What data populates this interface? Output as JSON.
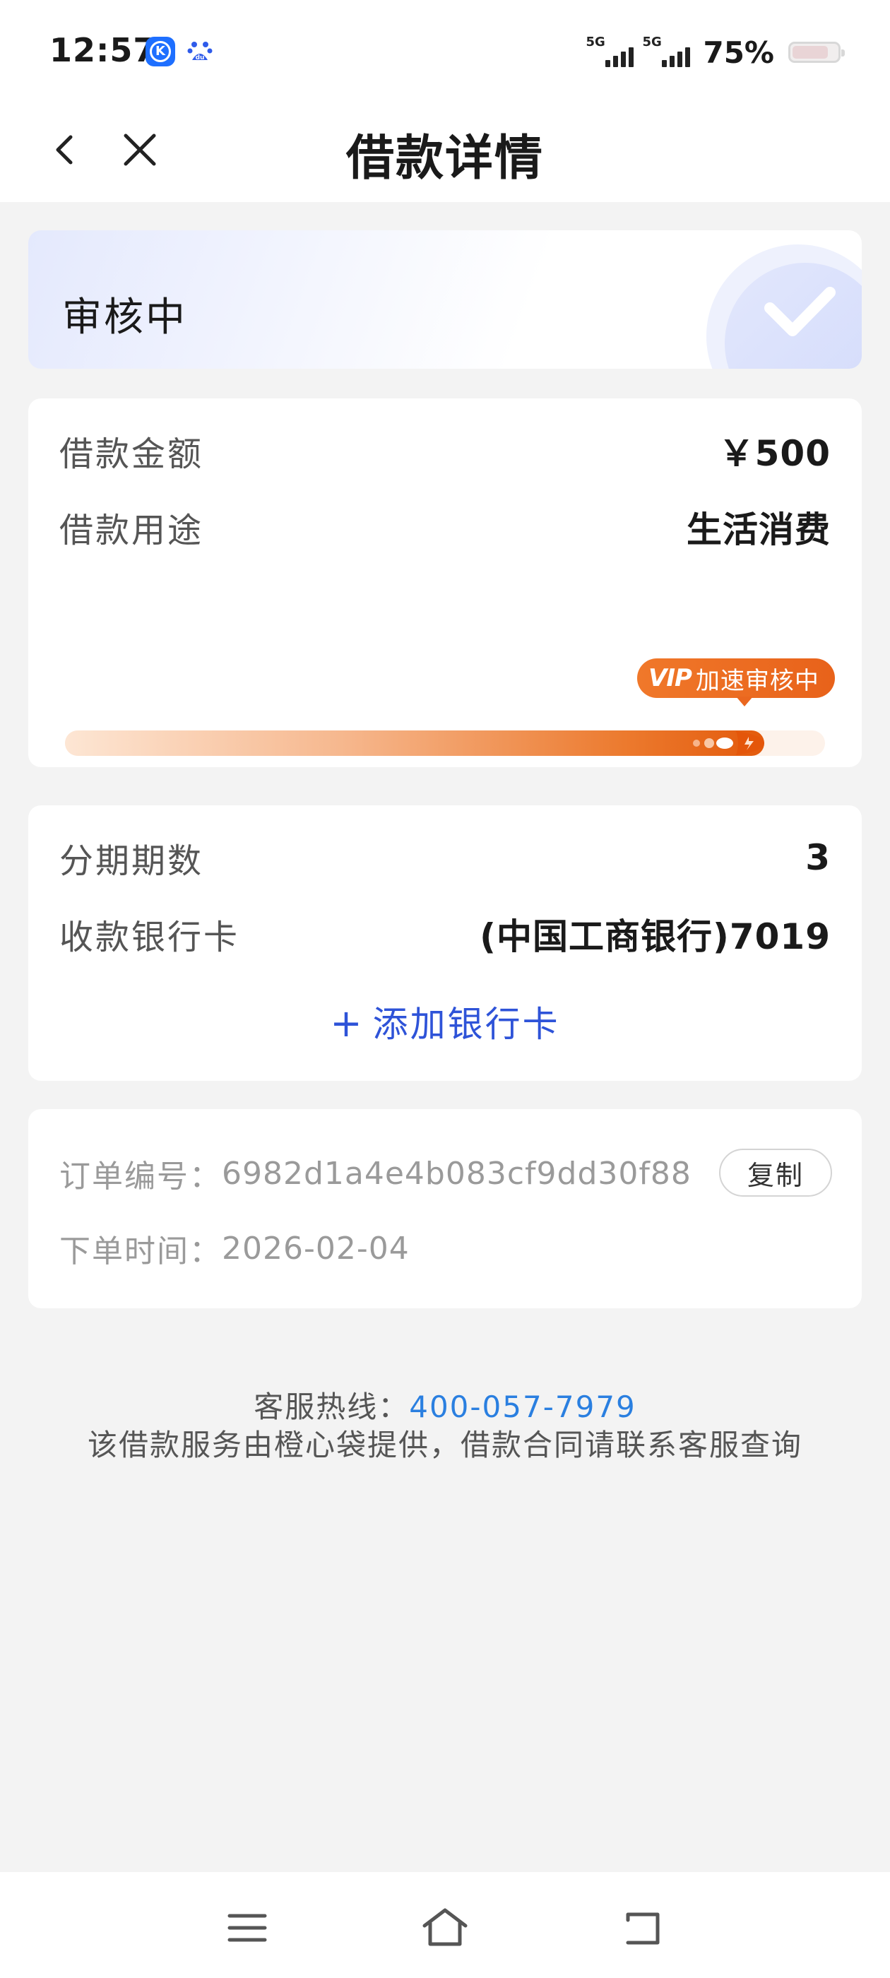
{
  "status_bar": {
    "time": "12:57",
    "app_icons": [
      {
        "name": "k-app-icon",
        "glyph": "K",
        "color": "#1e6fff"
      },
      {
        "name": "baidu-paw-icon",
        "glyph": "du",
        "color": "#2f5bea"
      }
    ],
    "network_tag_1": "5G",
    "network_tag_2": "5G",
    "battery_percent": "75%",
    "battery_level": 0.75
  },
  "header": {
    "title": "借款详情",
    "back_icon": "chevron-left-icon",
    "close_icon": "close-icon"
  },
  "status_card": {
    "status_text": "审核中",
    "decor_icon": "check-circle-icon"
  },
  "loan_card": {
    "amount_label": "借款金额",
    "amount_value": "￥500",
    "purpose_label": "借款用途",
    "purpose_value": "生活消费",
    "progress_fraction": 0.92,
    "badge_mark": "VIP",
    "badge_text": "加速审核中"
  },
  "installment_card": {
    "periods_label": "分期期数",
    "periods_value": "3",
    "bank_label": "收款银行卡",
    "bank_value": "(中国工商银行)7019",
    "add_card_label": "添加银行卡"
  },
  "order_card": {
    "order_no_label": "订单编号：",
    "order_no_value": "6982d1a4e4b083cf9dd30f88",
    "copy_label": "复制",
    "order_time_label": "下单时间：",
    "order_time_value": "2026-02-04"
  },
  "footer": {
    "hotline_label": "客服热线：",
    "hotline_number": "400-057-7979",
    "note": "该借款服务由橙心袋提供，借款合同请联系客服查询"
  },
  "colors": {
    "accent_blue": "#2e53d8",
    "link_blue": "#2a7fe0",
    "vip_orange": "#e8621a",
    "background": "#f3f3f3"
  }
}
